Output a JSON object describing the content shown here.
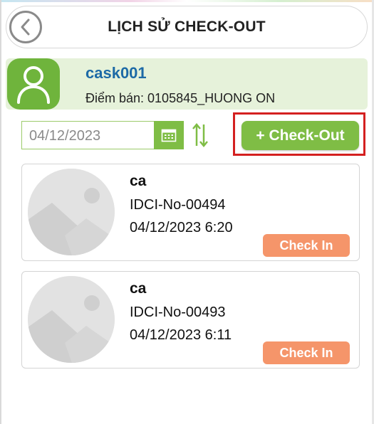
{
  "header": {
    "title": "LỊCH SỬ CHECK-OUT",
    "back_icon": "chevron-left-icon"
  },
  "profile": {
    "username": "cask001",
    "store": "Điểm bán: 0105845_HUONG ON",
    "avatar_icon": "user-icon"
  },
  "filter": {
    "date": "04/12/2023",
    "calendar_icon": "calendar-icon",
    "sort_icon": "sort-arrows-icon",
    "checkout_label": "+ Check-Out"
  },
  "records": [
    {
      "name": "ca",
      "code": "IDCI-No-00494",
      "time": "04/12/2023 6:20",
      "action_label": "Check In"
    },
    {
      "name": "ca",
      "code": "IDCI-No-00493",
      "time": "04/12/2023 6:11",
      "action_label": "Check In"
    }
  ],
  "colors": {
    "accent_green": "#7fbd45",
    "profile_bg": "#e6f2da",
    "username_blue": "#1d6aa6",
    "checkin_orange": "#f5956a",
    "highlight_red": "#d42020"
  }
}
